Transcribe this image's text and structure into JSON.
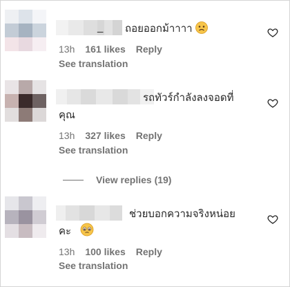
{
  "comments": [
    {
      "text_line1": "ถอยออกม้าาาา",
      "text_line2": "",
      "time": "13h",
      "likes": "161 likes",
      "reply": "Reply",
      "see_translation": "See translation",
      "emoji": "worried-face",
      "name_underscore": "_"
    },
    {
      "text_line1": "รถทัวร์กำลังลงจอดที่",
      "text_line2": "คุณ",
      "time": "13h",
      "likes": "327 likes",
      "reply": "Reply",
      "see_translation": "See translation"
    },
    {
      "text_line1": "ช่วยบอกความจริงหน่อย",
      "text_line2": "คะ",
      "time": "13h",
      "likes": "100 likes",
      "reply": "Reply",
      "see_translation": "See translation",
      "emoji": "pleading-face"
    }
  ],
  "view_replies": "View replies (19)",
  "colors": {
    "text": "#262626",
    "secondary": "#737373"
  }
}
